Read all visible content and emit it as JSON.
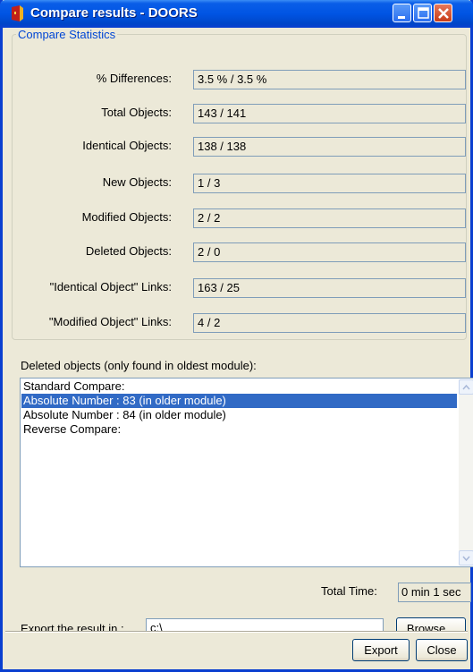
{
  "window": {
    "title": "Compare results - DOORS"
  },
  "stats": {
    "legend": "Compare Statistics",
    "rows": [
      {
        "label": "% Differences:",
        "value": "3.5 % / 3.5 %"
      },
      {
        "label": "Total Objects:",
        "value": "143 / 141"
      },
      {
        "label": "Identical Objects:",
        "value": "138 / 138"
      },
      {
        "label": "New Objects:",
        "value": "1 / 3"
      },
      {
        "label": "Modified Objects:",
        "value": "2 / 2"
      },
      {
        "label": "Deleted Objects:",
        "value": "2 / 0"
      },
      {
        "label": "\"Identical Object\" Links:",
        "value": "163 / 25"
      },
      {
        "label": "\"Modified Object\" Links:",
        "value": "4 / 2"
      }
    ]
  },
  "deleted": {
    "caption": "Deleted objects (only found in oldest module):",
    "items": [
      "Standard Compare:",
      "Absolute Number : 83 (in older module)",
      "Absolute Number : 84 (in older module)",
      "Reverse Compare:"
    ],
    "selected_index": 1
  },
  "time": {
    "label": "Total Time:",
    "value": "0 min 1 sec"
  },
  "export": {
    "label": "Export the result in :",
    "path": "c:\\"
  },
  "buttons": {
    "browse": "Browse...",
    "export": "Export",
    "close": "Close"
  },
  "colors": {
    "title_bar": "#0054e3",
    "selection": "#316ac5",
    "legend_text": "#0046d5"
  }
}
